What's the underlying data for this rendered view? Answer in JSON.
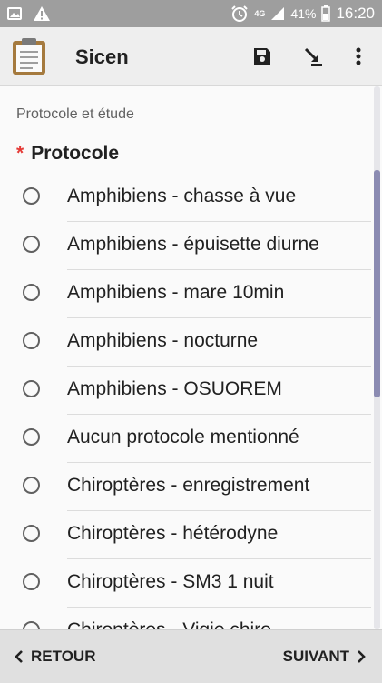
{
  "status_bar": {
    "network": "4G",
    "battery": "41%",
    "time": "16:20"
  },
  "app": {
    "title": "Sicen"
  },
  "form": {
    "section_title": "Protocole et étude",
    "required_marker": "*",
    "question": "Protocole",
    "options": [
      "Amphibiens - chasse à vue",
      "Amphibiens - épuisette diurne",
      "Amphibiens - mare 10min",
      "Amphibiens - nocturne",
      "Amphibiens - OSUOREM",
      "Aucun protocole mentionné",
      "Chiroptères - enregistrement",
      "Chiroptères - hétérodyne",
      "Chiroptères - SM3 1 nuit",
      "Chiroptères - Vigie chiro"
    ]
  },
  "nav": {
    "back_label": "RETOUR",
    "next_label": "SUIVANT"
  },
  "icons": {
    "status_left": [
      "image-icon",
      "warning-icon"
    ],
    "status_right": [
      "alarm-icon",
      "signal-icon",
      "battery-icon"
    ],
    "appbar": [
      "clipboard-icon",
      "save-icon",
      "jump-icon",
      "more-vert-icon"
    ],
    "nav": [
      "chevron-left-icon",
      "chevron-right-icon"
    ]
  }
}
